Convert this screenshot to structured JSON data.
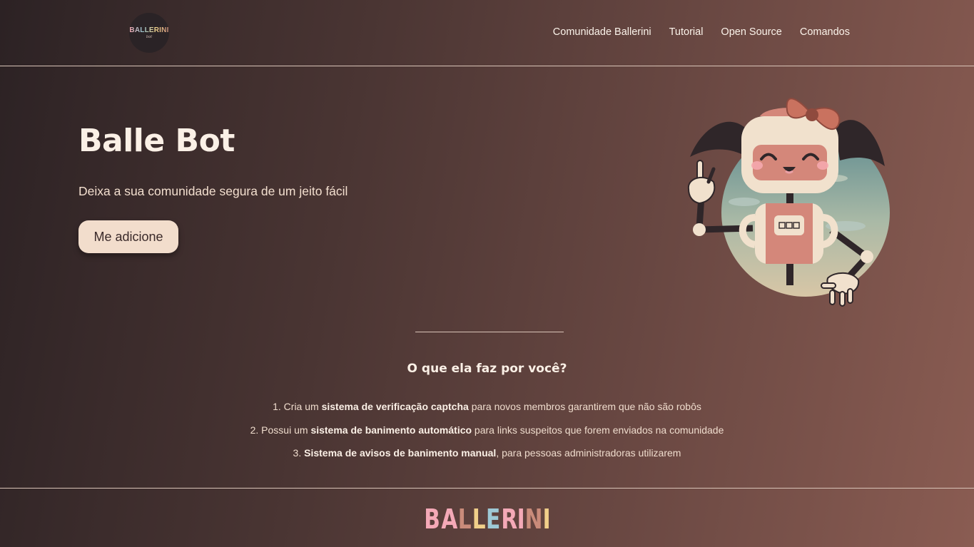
{
  "header": {
    "logo_text": "BALLERINI",
    "logo_sub": "bot",
    "nav": [
      {
        "label": "Comunidade Ballerini"
      },
      {
        "label": "Tutorial"
      },
      {
        "label": "Open Source"
      },
      {
        "label": "Comandos"
      }
    ]
  },
  "hero": {
    "title": "Balle Bot",
    "subtitle": "Deixa a sua comunidade segura de um jeito fácil",
    "cta_label": "Me adicione"
  },
  "section": {
    "title": "O que ela faz por você?",
    "features": [
      {
        "prefix": "1. Cria um ",
        "bold": "sistema de verificação captcha",
        "suffix": " para novos membros garantirem que não são robôs"
      },
      {
        "prefix": "2. Possui um ",
        "bold": "sistema de banimento automático",
        "suffix": " para links suspeitos que forem enviados na comunidade"
      },
      {
        "prefix": "3. ",
        "bold": "Sistema de avisos de banimento manual",
        "suffix": ", para pessoas administradoras utilizarem"
      }
    ]
  },
  "footer": {
    "brand_letters": [
      "B",
      "A",
      "L",
      "L",
      "E",
      "R",
      "I",
      "N",
      "I"
    ],
    "brand_colors": [
      "#f4a9b7",
      "#f4a9b7",
      "#c98b7a",
      "#f1cf8a",
      "#9ec9d6",
      "#f4a9b7",
      "#f4a9b7",
      "#c98b7a",
      "#f1cf8a"
    ]
  },
  "colors": {
    "accent": "#f2ddcc",
    "text": "#fbf0e6",
    "line": "#d9c4b8"
  }
}
